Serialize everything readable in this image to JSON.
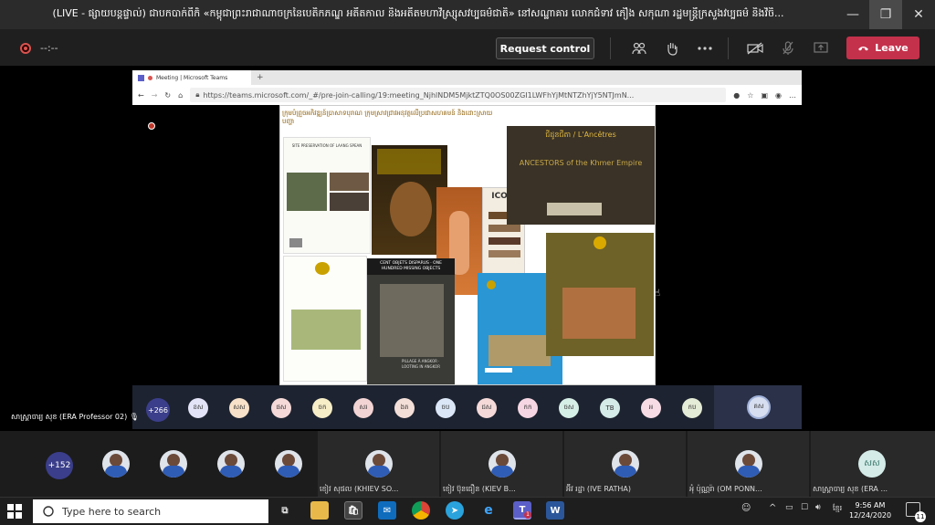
{
  "window": {
    "title": "(LIVE - ផ្សាយបន្តផ្ទាល់) ជាបកបាក់ពីក៏ «កម្ពុជាព្រះរាជាណាចក្រនៃបេតិកភណ្ឌ អតីតកាល និងអតីតមហាវិស្ស្រុសវប្បធម៌ជាតិ» នៅសណ្ឋាគារ លោកជំទាវ ភឿង សកុណា រដ្ឋមន្ត្រីក្រសួងវប្បធម៌ និងវិចិ...",
    "controls": {
      "minimize": "—",
      "maximize": "❐",
      "close": "✕"
    }
  },
  "toolbar": {
    "timer": "--:--",
    "request_control": "Request control",
    "leave": "Leave"
  },
  "browser": {
    "tab_title": "Meeting | Microsoft Teams",
    "new_tab": "+",
    "url": "https://teams.microsoft.com/_#/pre-join-calling/19:meeting_NjhlNDM5MjktZTQ0OS00ZGI1LWFhYjMtNTZhYjY5NTJmN..."
  },
  "slide": {
    "caption": "ក្រុមបំព្រួចអភិវឌ្ឍន៍ប្រាសាទបុរាណ ក្រុមស្រាវជ្រាវអនុវត្តលើប្រជាសហគមន៍ និងដោះស្រាយបញ្ហា",
    "doc1_title": "SITE PRESERVATION OF LAANG SPEAN",
    "doc2_title": "CENT OBJETS DISPARUS · ONE HUNDRED MISSING OBJECTS",
    "doc3_title": "ANCESTORS of the Khmer Empire",
    "doc3_subtitle": "ជីដូនជីតា / L'Ancêtres",
    "doc4_label": "PILLAGE À ANGKOR · LOOTING IN ANGKOR",
    "doc5_label": "ICOM"
  },
  "strip": {
    "count": "+266",
    "speaker": "សាស្ត្រាចារ្យ សុខ (ERA Professor 02)",
    "initials": [
      "ខស",
      "សស",
      "ផស",
      "ចក",
      "សរ",
      "ងត",
      "ចប",
      "ជស",
      "កក",
      "ចស",
      "TB",
      "អ",
      "កប"
    ],
    "right_initials": "គស"
  },
  "gallery": {
    "count": "+152",
    "names": [
      "ខៀវ សុផល (KHIEV SO...",
      "ខៀវ ប៊ុនធឿន (KIEV B...",
      "អ៊ីវ រដ្ឋា (IVE RATHA)",
      "អុំ ប៉ុណ្ណរ៉ា (OM PONN...",
      "សាស្ត្រាចារ្យ សុខ (ERA ..."
    ],
    "last_initials": "សស"
  },
  "taskbar": {
    "search_placeholder": "Type here to search",
    "time": "9:56 AM",
    "date": "12/24/2020",
    "notif_count": "11",
    "lang": "ខ្មែរ",
    "teams_badge": "1",
    "word_label": "W"
  },
  "colors": {
    "leave": "#c4314b",
    "titlebar": "#2b2b2b",
    "avatar_purple": "#3b3e8a"
  }
}
